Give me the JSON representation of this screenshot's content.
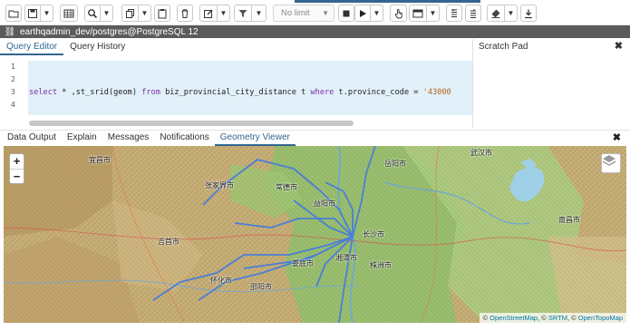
{
  "toolbar": {
    "limit_select": "No limit",
    "accent_color": "#326690"
  },
  "connection": {
    "label": "earthqadmin_dev/postgres@PostgreSQL 12",
    "bar_color": "#5b5b5b"
  },
  "editor_tabs": {
    "query_editor": "Query Editor",
    "query_history": "Query History"
  },
  "scratch_pad": {
    "title": "Scratch Pad",
    "close": "✖"
  },
  "editor": {
    "line_numbers": [
      "1",
      "2",
      "3",
      "4"
    ],
    "code": {
      "kw_select": "select",
      "part1": " * ,st_srid(geom) ",
      "kw_from": "from",
      "part2": " biz_provincial_city_distance t ",
      "kw_where": "where",
      "part3": " t.province_code = ",
      "str": "'43000"
    },
    "highlight_color": "#e1f0f9"
  },
  "output_tabs": {
    "data_output": "Data Output",
    "explain": "Explain",
    "messages": "Messages",
    "notifications": "Notifications",
    "geometry_viewer": "Geometry Viewer",
    "close": "✖"
  },
  "map": {
    "zoom_in": "+",
    "zoom_out": "−",
    "attribution_sep1": " © ",
    "attribution_osm": "OpenStreetMap",
    "attribution_sep2": ", © ",
    "attribution_srtm": "SRTM",
    "attribution_sep3": ", © ",
    "attribution_otm": "OpenTopoMap",
    "line_color": "#4a7fd6",
    "labels": {
      "zhangjiajie": "张家界市",
      "yueyang": "岳阳市",
      "changde": "常德市",
      "yiyang": "益阳市",
      "huaihua": "怀化市",
      "changsha": "长沙市",
      "xiangtan": "湘潭市",
      "zhuzhou": "株洲市",
      "loudi": "娄底市",
      "jishou": "吉首市",
      "yichang": "宜昌市",
      "nanchang": "南昌市",
      "wuhan": "武汉市",
      "shaoyang": "邵阳市"
    }
  }
}
